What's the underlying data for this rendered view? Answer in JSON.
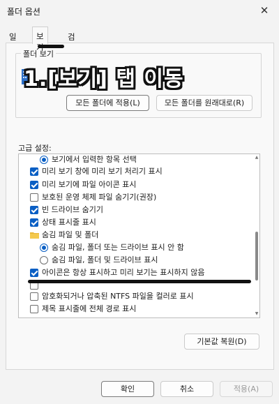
{
  "window": {
    "title": "폴더 옵션"
  },
  "tabs": [
    {
      "label": "일반",
      "active": false
    },
    {
      "label": "보기",
      "active": true
    },
    {
      "label": "검색",
      "active": false
    }
  ],
  "folder_view": {
    "group_label": "폴더 보기",
    "desc_fragment": "적",
    "apply_all_button": "모든 폴더에 적용(L)",
    "reset_folders_button": "모든 폴더를 원래대로(R)"
  },
  "advanced": {
    "label": "고급 설정:",
    "items": [
      {
        "kind": "radio",
        "checked": true,
        "label": "보기에서 입력한 항목 선택"
      },
      {
        "kind": "check",
        "checked": true,
        "label": "미리 보기 창에 미리 보기 처리기 표시"
      },
      {
        "kind": "check",
        "checked": true,
        "label": "미리 보기에 파일 아이콘 표시"
      },
      {
        "kind": "check",
        "checked": false,
        "label": "보호된 운영 체제 파일 숨기기(권장)"
      },
      {
        "kind": "check",
        "checked": true,
        "label": "빈 드라이브 숨기기"
      },
      {
        "kind": "check",
        "checked": true,
        "label": "상태 표시줄 표시"
      },
      {
        "kind": "folder",
        "checked": false,
        "label": "숨김 파일 및 폴더"
      },
      {
        "kind": "radio",
        "checked": true,
        "label": "숨김 파일, 폴더 또는 드라이브 표시 안 함"
      },
      {
        "kind": "radio",
        "checked": false,
        "label": "숨김 파일, 폴더 및 드라이브 표시"
      },
      {
        "kind": "check",
        "checked": true,
        "label": "아이콘은 항상 표시하고 미리 보기는 표시하지 않음"
      },
      {
        "kind": "check",
        "checked": false,
        "label": ""
      },
      {
        "kind": "check",
        "checked": false,
        "label": "암호화되거나 압축된 NTFS 파일을 컬러로 표시"
      },
      {
        "kind": "check",
        "checked": false,
        "label": "제목 표시줄에 전체 경로 표시"
      },
      {
        "kind": "check",
        "checked": true,
        "label": ""
      }
    ]
  },
  "buttons": {
    "restore_defaults": "기본값 복원(D)",
    "ok": "확인",
    "cancel": "취소",
    "apply": "적용(A)"
  },
  "annotation": {
    "text": "1.[보기] 탭 이동"
  }
}
